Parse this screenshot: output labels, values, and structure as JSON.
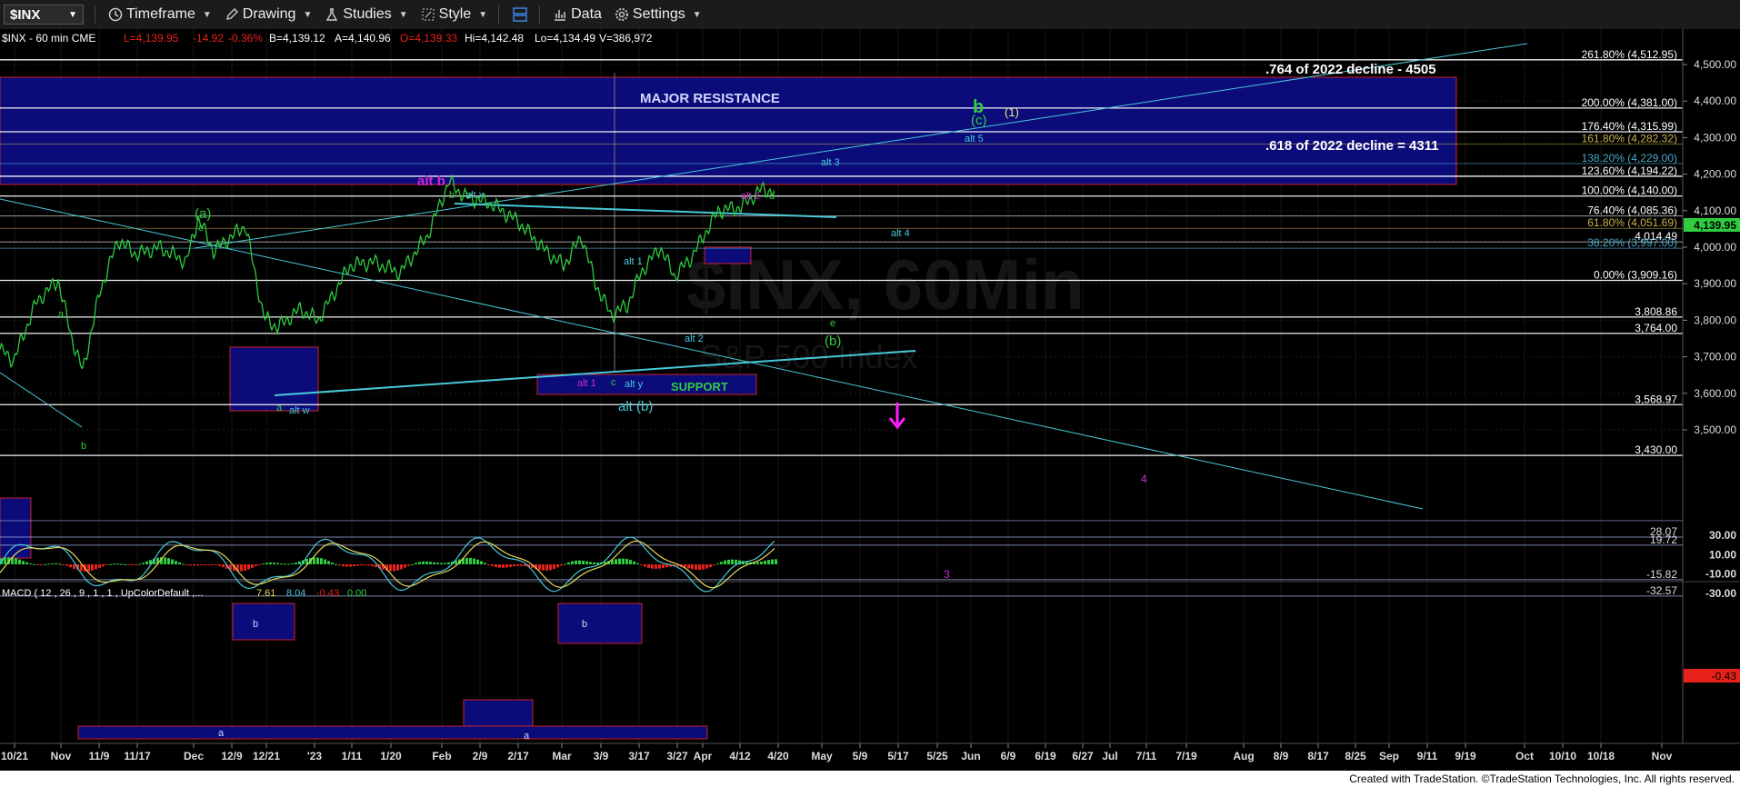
{
  "toolbar": {
    "symbol": "$INX",
    "buttons": [
      {
        "id": "timeframe",
        "label": "Timeframe",
        "icon": "clock-icon"
      },
      {
        "id": "drawing",
        "label": "Drawing",
        "icon": "pencil-icon"
      },
      {
        "id": "studies",
        "label": "Studies",
        "icon": "flask-icon"
      },
      {
        "id": "style",
        "label": "Style",
        "icon": "style-icon"
      },
      {
        "id": "data",
        "label": "Data",
        "icon": "bar-chart-icon"
      },
      {
        "id": "settings",
        "label": "Settings",
        "icon": "gear-icon"
      }
    ]
  },
  "header": {
    "symbol_info": "$INX - 60 min  CME",
    "low": "L=4,139.95",
    "chg": "-14.92",
    "pct": "-0.36%",
    "bid": "B=4,139.12",
    "ask": "A=4,140.96",
    "open": "O=4,139.33",
    "high": "Hi=4,142.48",
    "lo": "Lo=4,134.49",
    "vol": "V=386,972"
  },
  "colors": {
    "bg": "#000000",
    "up": "#2ecc40",
    "down": "#e8211b",
    "fib": "#ffffff",
    "teal": "#48c8d8",
    "purple": "#d12ad1",
    "zone": "#0b0b7a"
  },
  "watermark": {
    "line1": "$INX, 60Min",
    "line2": "S&P 500 Index"
  },
  "chart_data": [
    {
      "type": "line",
      "name": "price",
      "ylim": [
        3390,
        4545
      ],
      "y_ticks": [
        4500,
        4400,
        4300,
        4200,
        4100,
        4000,
        3900,
        3800,
        3700,
        3600,
        3500
      ],
      "y_tick_labels": [
        "4,500.00",
        "4,400.00",
        "4,300.00",
        "4,200.00",
        "4,100.00",
        "4,000.00",
        "3,900.00",
        "3,800.00",
        "3,700.00",
        "3,600.00",
        "3,500.00"
      ],
      "x_tick_labels": [
        "10/21",
        "Nov",
        "11/9",
        "11/17",
        "Dec",
        "12/9",
        "12/21",
        "'23",
        "1/11",
        "1/20",
        "Feb",
        "2/9",
        "2/17",
        "Mar",
        "3/9",
        "3/17",
        "3/27",
        "Apr",
        "4/12",
        "4/20",
        "May",
        "5/9",
        "5/17",
        "5/25",
        "Jun",
        "6/9",
        "6/19",
        "6/27",
        "Jul",
        "7/11",
        "7/19",
        "Aug",
        "8/9",
        "8/17",
        "8/25",
        "Sep",
        "9/11",
        "9/19",
        "Oct",
        "10/10",
        "10/18",
        "Nov"
      ],
      "last_price": "4,139.95",
      "levels": [
        {
          "v": 4512.95,
          "label": "261.80% (4,512.95)"
        },
        {
          "v": 4381,
          "label": "200.00% (4,381.00)"
        },
        {
          "v": 4315.99,
          "label": "176.40% (4,315.99)"
        },
        {
          "v": 4282.32,
          "label": "161.80% (4,282.32)"
        },
        {
          "v": 4229,
          "label": "138.20% (4,229.00)"
        },
        {
          "v": 4194.22,
          "label": "123.60% (4,194.22)"
        },
        {
          "v": 4140,
          "label": "100.00% (4,140.00)"
        },
        {
          "v": 4085.36,
          "label": "76.40% (4,085.36)"
        },
        {
          "v": 4051.69,
          "label": "61.80% (4,051.69)"
        },
        {
          "v": 4014.49,
          "label": "4,014.49"
        },
        {
          "v": 3997,
          "label": "38.20% (3,997.00)"
        },
        {
          "v": 3909.16,
          "label": "0.00% (3,909.16)"
        },
        {
          "v": 3808.86,
          "label": "3,808.86"
        },
        {
          "v": 3764,
          "label": "3,764.00"
        },
        {
          "v": 3568.97,
          "label": "3,568.97"
        },
        {
          "v": 3430,
          "label": "3,430.00"
        }
      ],
      "annotations": [
        {
          "text": ".764 of 2022 decline - 4505"
        },
        {
          "text": ".618 of 2022 decline = 4311"
        },
        {
          "text": "MAJOR RESISTANCE"
        },
        {
          "text": "SUPPORT"
        },
        {
          "text": "alt b"
        },
        {
          "text": "b"
        },
        {
          "text": "(c)"
        },
        {
          "text": "(1)"
        },
        {
          "text": "alt 5"
        },
        {
          "text": "alt 3"
        },
        {
          "text": "alt 4"
        },
        {
          "text": "alt x"
        },
        {
          "text": "alt 2"
        },
        {
          "text": "d"
        },
        {
          "text": "(a)"
        },
        {
          "text": "alt 1"
        },
        {
          "text": "e"
        },
        {
          "text": "(b)"
        },
        {
          "text": "alt y"
        },
        {
          "text": "alt (b)"
        },
        {
          "text": "alt w"
        },
        {
          "text": "a"
        },
        {
          "text": "c"
        },
        {
          "text": "4"
        },
        {
          "text": "3"
        }
      ]
    },
    {
      "type": "line",
      "name": "MACD ( 12 , 26 , 9 , 1 , 1 , UpColorDefault ,...",
      "values_text": {
        "macd": "7.61",
        "signal": "8.04",
        "hist": "-0.43",
        "zero": "0.00"
      },
      "ylim": [
        -40,
        40
      ],
      "y_ticks": [
        30,
        10,
        -10,
        -30
      ],
      "y_tick_labels": [
        "30.00",
        "10.00",
        "-10.00",
        "-30.00"
      ],
      "levels": [
        {
          "v": 28.07,
          "label": "28.07"
        },
        {
          "v": 19.72,
          "label": "19.72"
        },
        {
          "v": -15.82,
          "label": "-15.82"
        },
        {
          "v": -32.57,
          "label": "-32.57"
        }
      ],
      "last_value": "-0.43",
      "labels": [
        "b",
        "b",
        "a",
        "a"
      ]
    }
  ],
  "footer": "Created with TradeStation. ©TradeStation Technologies, Inc. All rights reserved."
}
